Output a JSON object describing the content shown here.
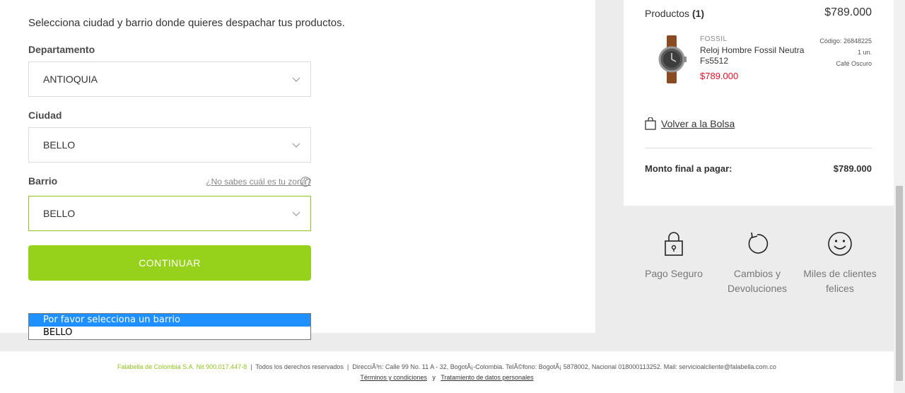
{
  "shipping": {
    "intro": "Selecciona ciudad y barrio donde quieres despachar tus productos.",
    "department_label": "Departamento",
    "department_value": "ANTIOQUIA",
    "city_label": "Ciudad",
    "city_value": "BELLO",
    "neighborhood_label": "Barrio",
    "neighborhood_value": "BELLO",
    "zone_help": "¿No sabes cuál es tu zona?",
    "help_symbol": "?",
    "continue_label": "CONTINUAR"
  },
  "dropdown": {
    "options": [
      "Por favor selecciona un barrio",
      "BELLO"
    ],
    "selected_index": 0
  },
  "summary": {
    "products_label": "Productos",
    "products_count": "(1)",
    "products_total": "$789.000",
    "product": {
      "brand": "FOSSIL",
      "name": "Reloj Hombre Fossil Neutra Fs5512",
      "price": "$789.000",
      "code": "Código: 26848225",
      "quantity": "1 un.",
      "color": "Café Oscuro"
    },
    "back_link": "Volver a la Bolsa",
    "final_label": "Monto final a pagar:",
    "final_value": "$789.000"
  },
  "benefits": [
    {
      "icon": "lock-icon",
      "label": "Pago Seguro"
    },
    {
      "icon": "refresh-icon",
      "label": "Cambios y Devoluciones"
    },
    {
      "icon": "smiley-icon",
      "label": "Miles de clientes felices"
    }
  ],
  "footer": {
    "company": "Falabella de Colombia S.A. Nit 900.017.447-8",
    "separator": "|",
    "rights": "Todos los derechos reservados",
    "address": "DirecciÃ³n: Calle 99 No. 11 A - 32, BogotÃ¡-Colombia. TelÃ©fono: BogotÃ¡ 5878002, Nacional 018000113252. Mail: servicioalcliente@falabella.com.co",
    "terms": "Términos y condiciones",
    "conjunction": "y",
    "privacy": "Tratamiento de datos personales"
  },
  "colors": {
    "accent_green": "#96d11b",
    "price_red": "#e0102a",
    "select_highlight": "#1e90ff"
  }
}
